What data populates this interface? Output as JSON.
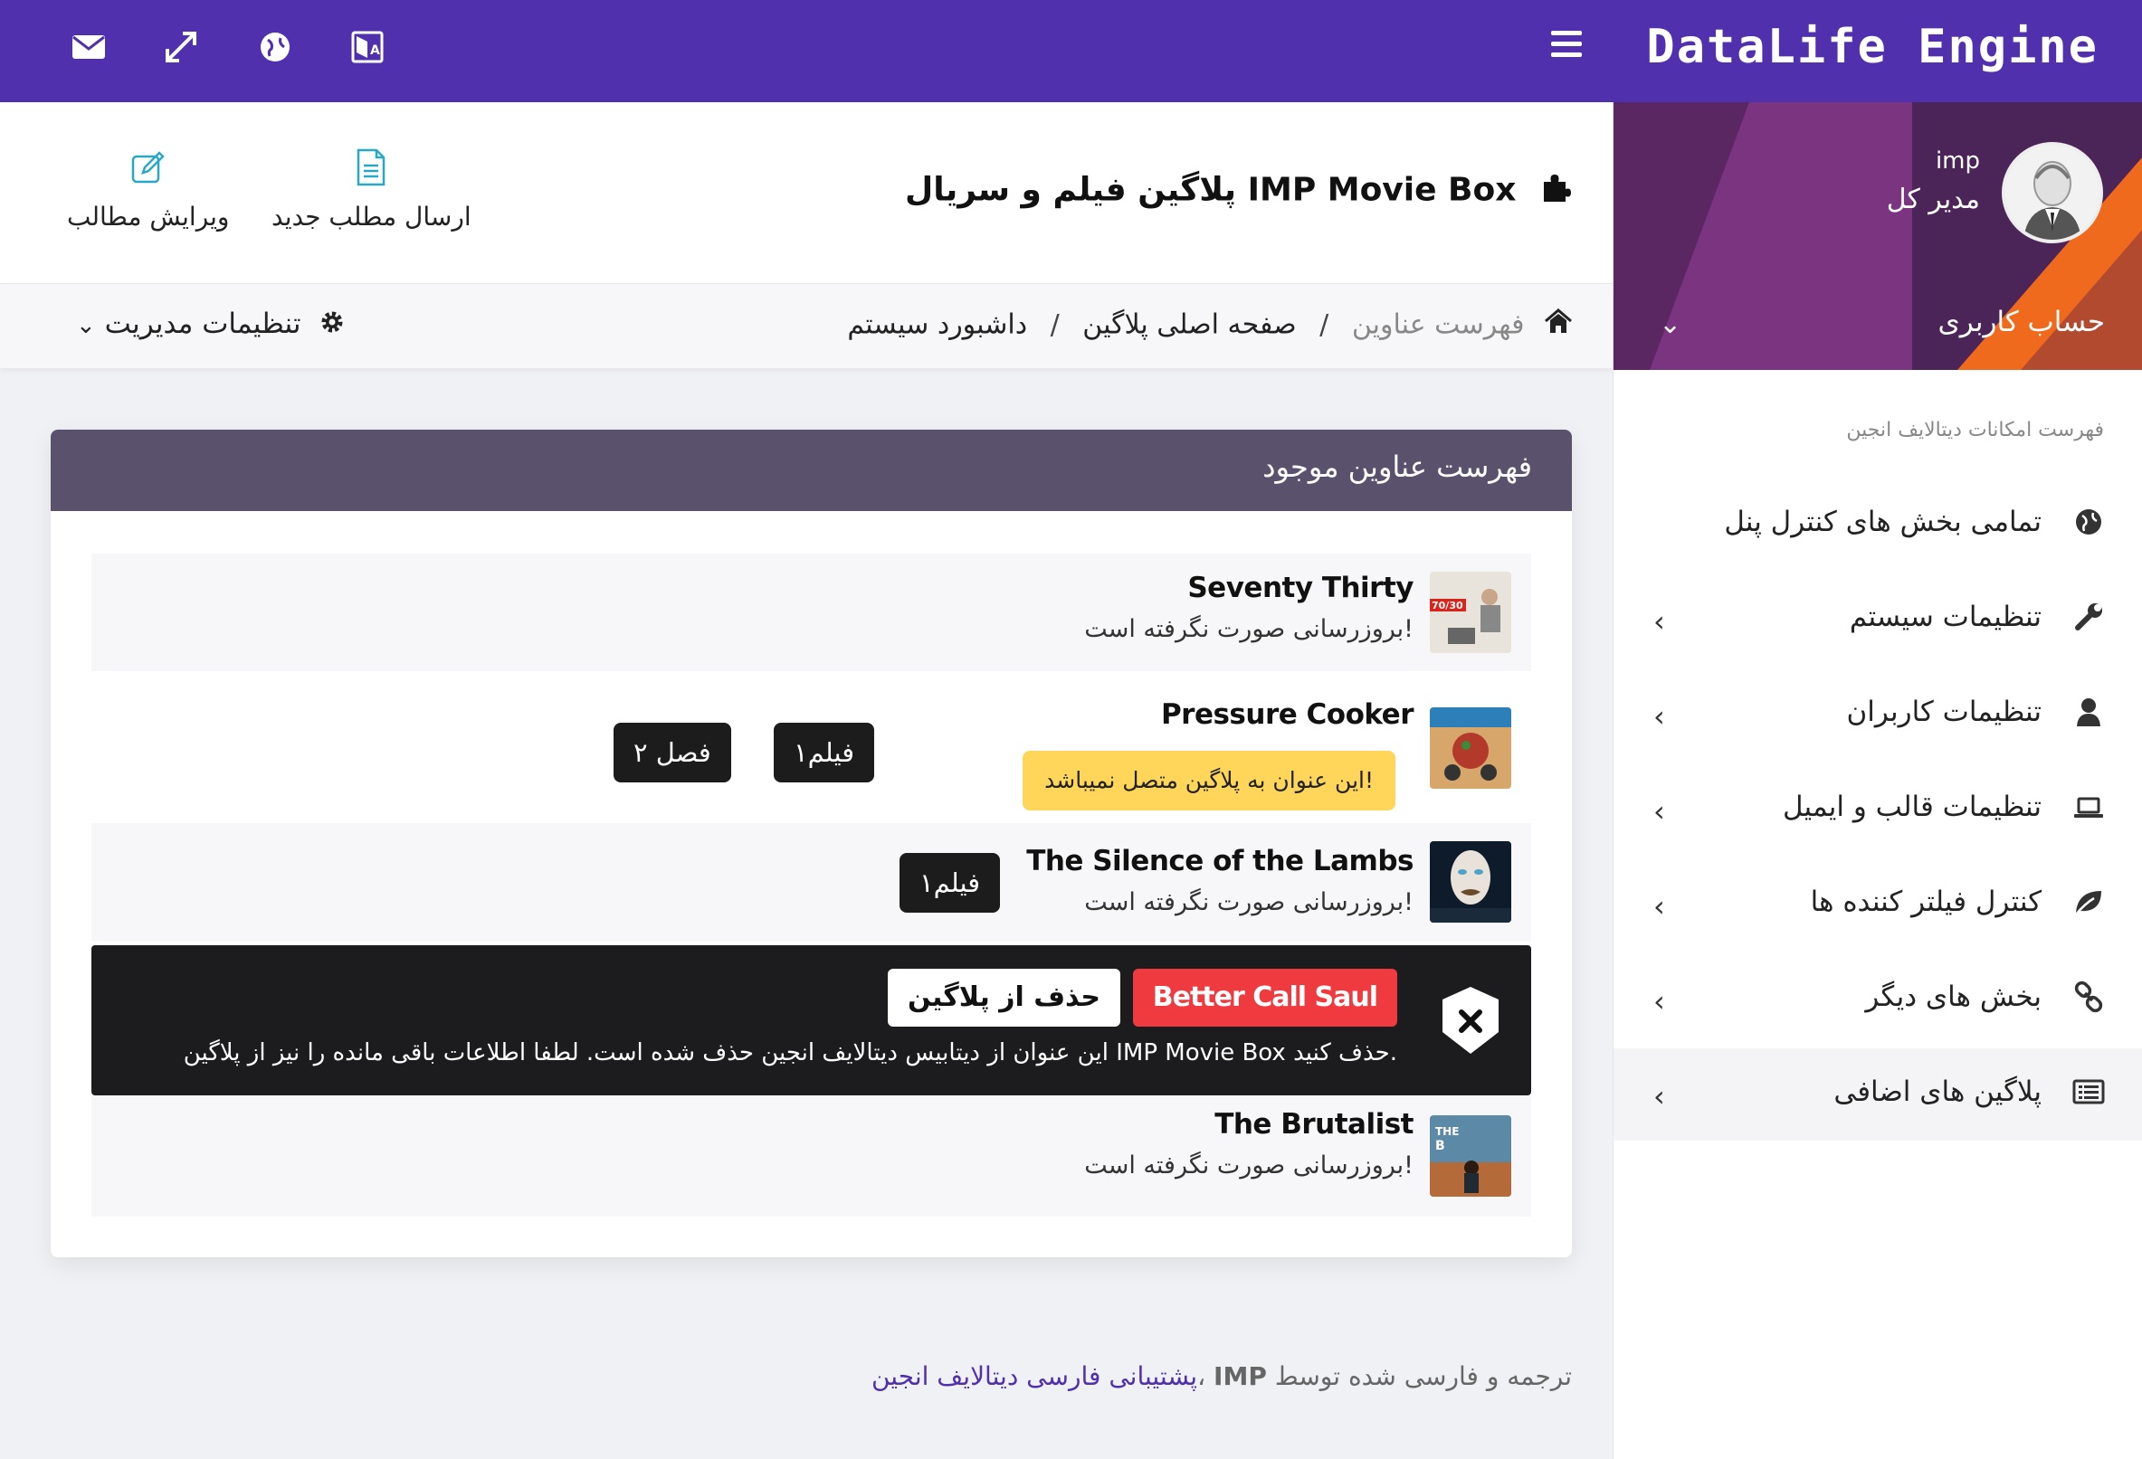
{
  "brand": "DataLife Engine",
  "colors": {
    "primary": "#5130ad",
    "accent_orange": "#f06a1e",
    "card_header": "#5a526c",
    "danger": "#ef3b3f",
    "warning": "#ffd65a",
    "icon_teal": "#29a8c6"
  },
  "topbar": {
    "icons": [
      "mail-icon",
      "expand-icon",
      "globe-icon",
      "translate-icon",
      "hamburger-menu-icon"
    ]
  },
  "profile": {
    "username": "imp",
    "role": "مدیر کل",
    "account_label": "حساب کاربری"
  },
  "sidebar": {
    "caption": "فهرست امکانات دیتالایف انجین",
    "items": [
      {
        "label": "تمامی بخش های کنترل پنل",
        "icon": "globe-icon",
        "has_chevron": false
      },
      {
        "label": "تنظیمات سیستم",
        "icon": "wrench-icon",
        "has_chevron": true
      },
      {
        "label": "تنظیمات کاربران",
        "icon": "user-icon",
        "has_chevron": true
      },
      {
        "label": "تنظیمات قالب و ایمیل",
        "icon": "laptop-icon",
        "has_chevron": true
      },
      {
        "label": "کنترل فیلتر کننده ها",
        "icon": "leaf-icon",
        "has_chevron": true
      },
      {
        "label": "بخش های دیگر",
        "icon": "link-icon",
        "has_chevron": true
      },
      {
        "label": "پلاگین های اضافی",
        "icon": "list-icon",
        "has_chevron": true,
        "active": true
      }
    ]
  },
  "header": {
    "title": "پلاگین فیلم و سریال IMP Movie Box",
    "quick_actions": [
      {
        "label": "ارسال مطلب جدید",
        "icon": "new-document-icon"
      },
      {
        "label": "ویرایش مطالب",
        "icon": "edit-icon"
      }
    ]
  },
  "breadcrumb": {
    "items": [
      "داشبورد سیستم",
      "صفحه اصلی پلاگین",
      "فهرست عناوین"
    ],
    "admin_settings": "تنظیمات مدیریت"
  },
  "card": {
    "title": "فهرست عناوین موجود",
    "rows": [
      {
        "title": "Seventy Thirty",
        "status": "بروزرسانی صورت نگرفته است!",
        "badges": []
      },
      {
        "title": "Pressure Cooker",
        "warning": "این عنوان به پلاگین متصل نمیباشد!",
        "badges": [
          "۲ فصل",
          "۱فیلم"
        ]
      },
      {
        "title": "The Silence of the Lambs",
        "status": "بروزرسانی صورت نگرفته است!",
        "badges": [
          "۱فیلم"
        ]
      },
      {
        "title": "The Brutalist",
        "status": "بروزرسانی صورت نگرفته است!",
        "badges": []
      }
    ],
    "deleted_item": {
      "title": "Better Call Saul",
      "action": "حذف از پلاگین",
      "message": "این عنوان از دیتابیس دیتالایف انجین حذف شده است. لطفا اطلاعات باقی مانده را نیز از پلاگین IMP Movie Box حذف کنید."
    }
  },
  "footer": {
    "prefix": "ترجمه و فارسی شده توسط ",
    "imp": "IMP",
    "sep": "، ",
    "link": "پشتیبانی فارسی دیتالایف انجین"
  }
}
